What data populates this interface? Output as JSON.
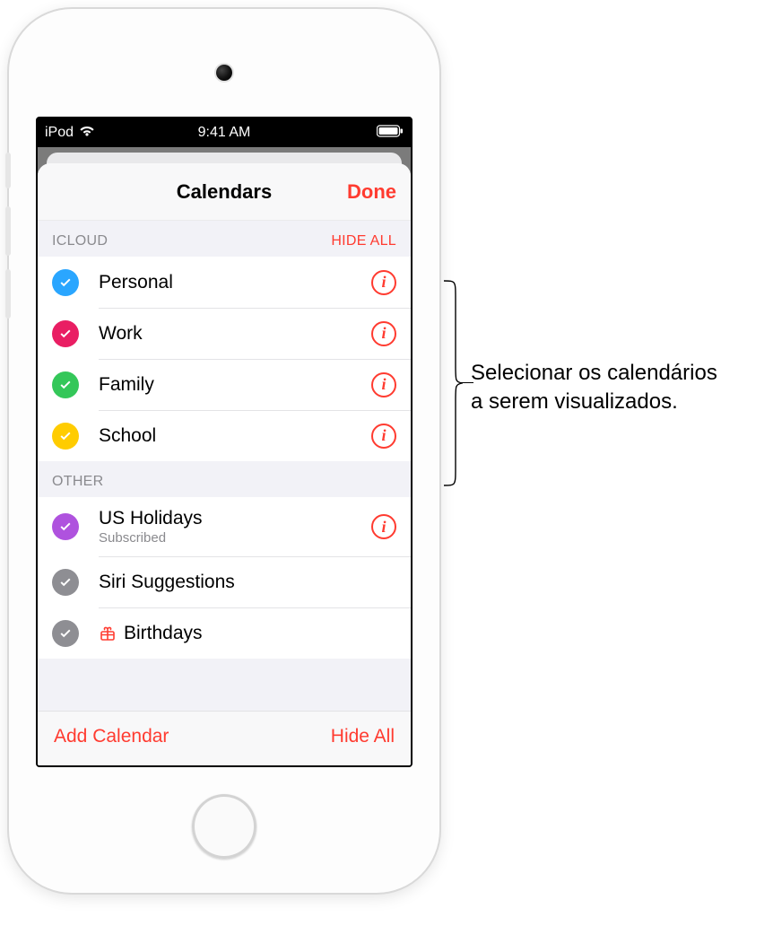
{
  "status_bar": {
    "carrier": "iPod",
    "time": "9:41 AM"
  },
  "sheet": {
    "title": "Calendars",
    "done": "Done"
  },
  "sections": {
    "icloud": {
      "title": "ICLOUD",
      "action": "HIDE ALL",
      "items": [
        {
          "label": "Personal",
          "color": "#2aa6ff",
          "has_info": true
        },
        {
          "label": "Work",
          "color": "#e91e63",
          "has_info": true
        },
        {
          "label": "Family",
          "color": "#34c759",
          "has_info": true
        },
        {
          "label": "School",
          "color": "#ffcc00",
          "has_info": true
        }
      ]
    },
    "other": {
      "title": "OTHER",
      "items": [
        {
          "label": "US Holidays",
          "sublabel": "Subscribed",
          "color": "#af52de",
          "has_info": true
        },
        {
          "label": "Siri Suggestions",
          "color": "#8e8e93",
          "has_info": false
        },
        {
          "label": "Birthdays",
          "color": "#8e8e93",
          "has_info": false,
          "gift": true
        }
      ]
    }
  },
  "footer": {
    "add": "Add Calendar",
    "hide_all": "Hide All"
  },
  "callout": {
    "line1": "Selecionar os calendários",
    "line2": "a serem visualizados."
  }
}
